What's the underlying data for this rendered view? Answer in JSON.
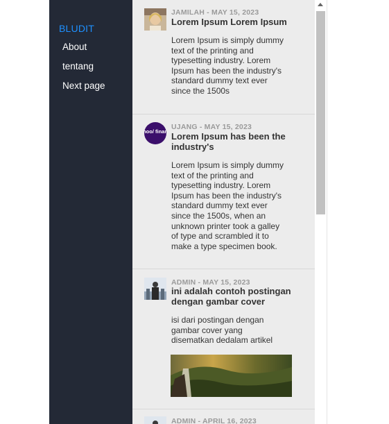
{
  "sidebar": {
    "brand": "BLUDIT",
    "items": [
      {
        "label": "About"
      },
      {
        "label": "tentang"
      },
      {
        "label": "Next page"
      }
    ]
  },
  "posts": [
    {
      "meta": "JAMILAH - MAY 15, 2023",
      "title": "Lorem Ipsum Lorem Ipsum",
      "excerpt_lines": [
        "Lorem Ipsum is simply dummy",
        "text of the printing and",
        "typesetting industry. Lorem",
        "Ipsum has been the industry's",
        "standard dummy text ever",
        "since the 1500s"
      ]
    },
    {
      "meta": "UJANG - MAY 15, 2023",
      "avatar_text": "yahoo/ finance",
      "title_lines": [
        "Lorem Ipsum has been the",
        "industry's"
      ],
      "excerpt_lines": [
        "Lorem Ipsum is simply dummy",
        "text of the printing and",
        "typesetting industry. Lorem",
        "Ipsum has been the industry's",
        "standard dummy text ever",
        "since the 1500s, when an",
        "unknown printer took a galley",
        "of type and scrambled it to",
        "make a type specimen book."
      ]
    },
    {
      "meta": "ADMIN - MAY 15, 2023",
      "title_lines": [
        "ini adalah contoh postingan",
        "dengan gambar cover"
      ],
      "excerpt_lines": [
        "isi dari postingan dengan",
        "gambar cover yang",
        "disematkan dedalam artikel"
      ]
    },
    {
      "meta": "ADMIN - APRIL 16, 2023"
    }
  ],
  "colors": {
    "sidebar_bg": "#232936",
    "brand": "#1e90ff",
    "content_bg": "#ececec",
    "meta": "#9a9a9a"
  }
}
